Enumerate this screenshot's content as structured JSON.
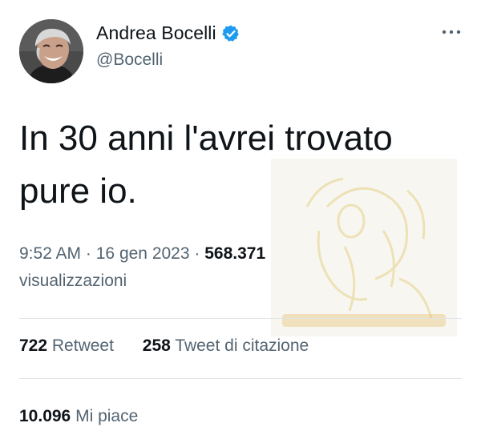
{
  "author": {
    "display_name": "Andrea Bocelli",
    "handle": "@Bocelli",
    "verified": true,
    "avatar_icon": "profile-photo-smiling-man"
  },
  "tweet": {
    "text": "In 30 anni l'avrei trovato pure io.",
    "time": "9:52 AM",
    "separator": "·",
    "date": "16 gen 2023",
    "views_count": "568.371",
    "views_label": "visualizzazioni"
  },
  "stats": {
    "retweets_count": "722",
    "retweets_label": "Retweet",
    "quotes_count": "258",
    "quotes_label": "Tweet di citazione",
    "likes_count": "10.096",
    "likes_label": "Mi piace"
  },
  "colors": {
    "text_primary": "#0f1419",
    "text_secondary": "#536471",
    "verified_badge": "#1d9bf0",
    "divider": "#dfe4e8"
  },
  "icons": {
    "more": "more-horizontal-icon",
    "verified": "verified-badge-icon"
  }
}
